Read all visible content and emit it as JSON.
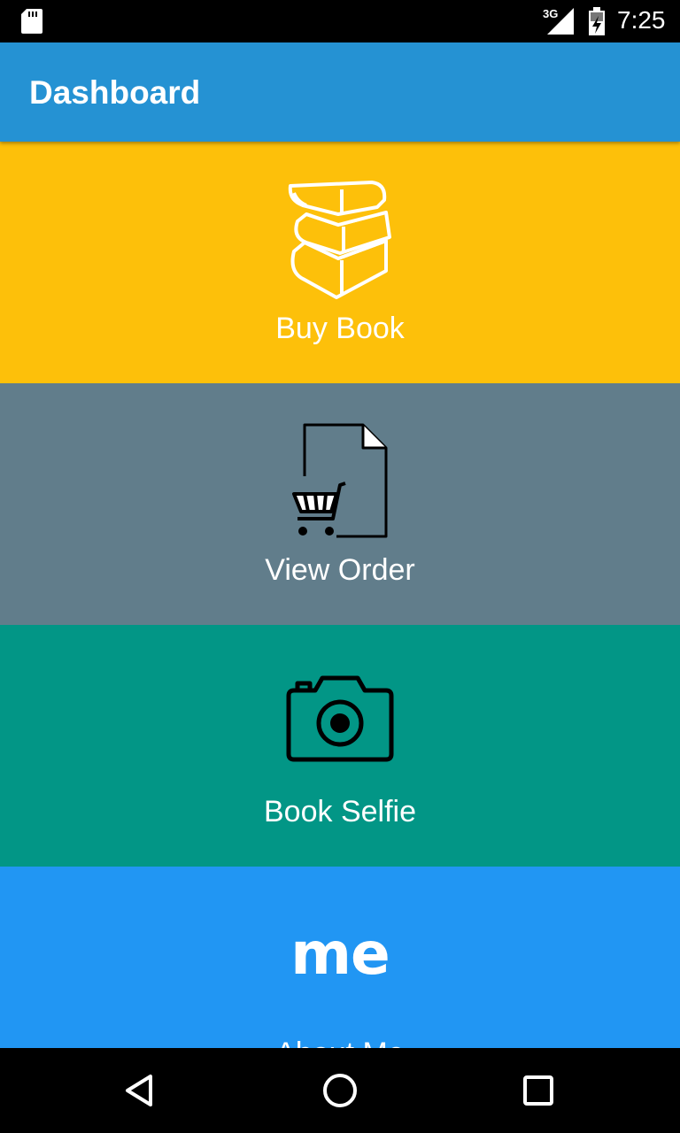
{
  "status_bar": {
    "network": "3G",
    "time": "7:25",
    "icons": [
      "sd-card-icon",
      "signal-icon",
      "battery-icon"
    ]
  },
  "app_bar": {
    "title": "Dashboard"
  },
  "tiles": [
    {
      "label": "Buy Book",
      "icon": "books-icon",
      "color": "#fdc00a"
    },
    {
      "label": "View Order",
      "icon": "order-cart-icon",
      "color": "#617d8b"
    },
    {
      "label": "Book Selfie",
      "icon": "camera-icon",
      "color": "#029686"
    },
    {
      "label": "About Me",
      "icon": "me-icon",
      "icon_text": "me",
      "color": "#2196f3"
    }
  ],
  "nav_bar": {
    "buttons": [
      "back-icon",
      "home-icon",
      "recents-icon"
    ]
  }
}
